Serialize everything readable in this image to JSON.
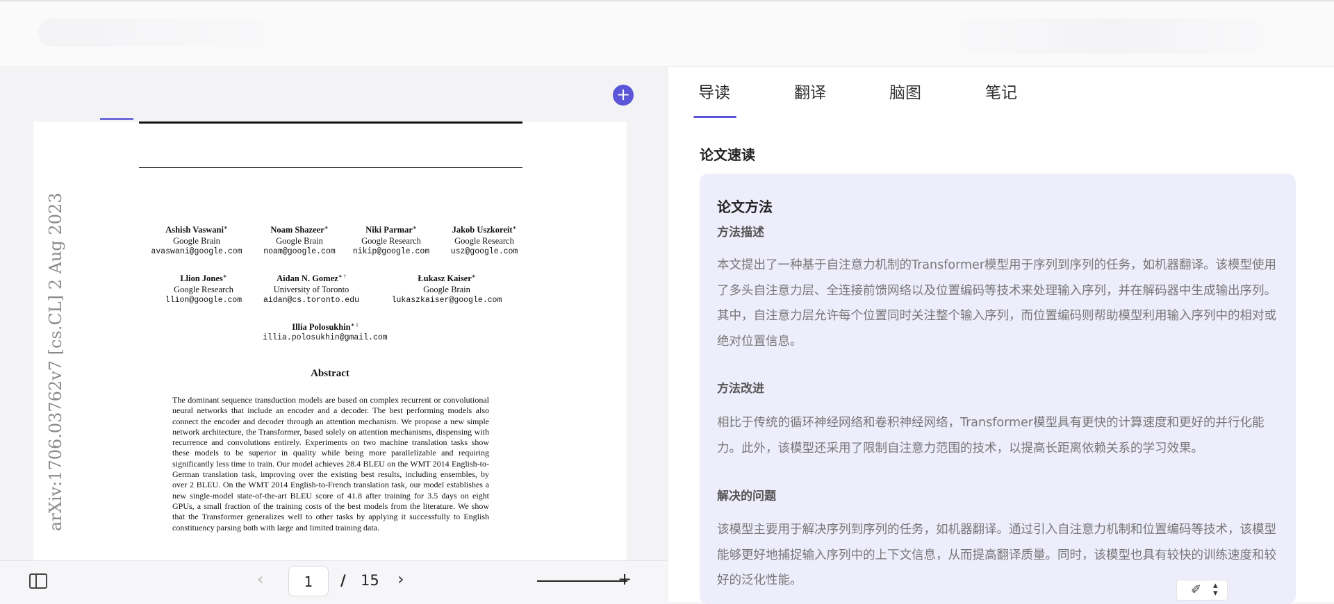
{
  "tabs": [
    {
      "label": "导读"
    },
    {
      "label": "翻译"
    },
    {
      "label": "脑图"
    },
    {
      "label": "笔记"
    }
  ],
  "section_title": "论文速读",
  "card": {
    "title": "论文方法",
    "method_desc_title": "方法描述",
    "method_desc": "本文提出了一种基于自注意力机制的Transformer模型用于序列到序列的任务，如机器翻译。该模型使用了多头自注意力层、全连接前馈网络以及位置编码等技术来处理输入序列，并在解码器中生成输出序列。其中，自注意力层允许每个位置同时关注整个输入序列，而位置编码则帮助模型利用输入序列中的相对或绝对位置信息。",
    "method_improve_title": "方法改进",
    "method_improve": "相比于传统的循环神经网络和卷积神经网络，Transformer模型具有更快的计算速度和更好的并行化能力。此外，该模型还采用了限制自注意力范围的技术，以提高长距离依赖关系的学习效果。",
    "problem_title": "解决的问题",
    "problem": "该模型主要用于解决序列到序列的任务，如机器翻译。通过引入自注意力机制和位置编码等技术，该模型能够更好地捕捉输入序列中的上下文信息，从而提高翻译质量。同时，该模型也具有较快的训练速度和较好的泛化性能。"
  },
  "pdf": {
    "arxiv_stamp": "arXiv:1706.03762v7  [cs.CL]  2 Aug 2023",
    "authors": [
      {
        "name": "Ashish Vaswani",
        "mark": "∗",
        "affil": "Google Brain",
        "email": "avaswani@google.com"
      },
      {
        "name": "Noam Shazeer",
        "mark": "∗",
        "affil": "Google Brain",
        "email": "noam@google.com"
      },
      {
        "name": "Niki Parmar",
        "mark": "∗",
        "affil": "Google Research",
        "email": "nikip@google.com"
      },
      {
        "name": "Jakob Uszkoreit",
        "mark": "∗",
        "affil": "Google Research",
        "email": "usz@google.com"
      },
      {
        "name": "Llion Jones",
        "mark": "∗",
        "affil": "Google Research",
        "email": "llion@google.com"
      },
      {
        "name": "Aidan N. Gomez",
        "mark": "∗ †",
        "affil": "University of Toronto",
        "email": "aidan@cs.toronto.edu"
      },
      {
        "name": "Łukasz Kaiser",
        "mark": "∗",
        "affil": "Google Brain",
        "email": "lukaszkaiser@google.com"
      },
      {
        "name": "Illia Polosukhin",
        "mark": "∗ ‡",
        "affil": "",
        "email": "illia.polosukhin@gmail.com"
      }
    ],
    "abstract_title": "Abstract",
    "abstract": "The dominant sequence transduction models are based on complex recurrent or convolutional neural networks that include an encoder and a decoder. The best performing models also connect the encoder and decoder through an attention mechanism. We propose a new simple network architecture, the Transformer, based solely on attention mechanisms, dispensing with recurrence and convolutions entirely. Experiments on two machine translation tasks show these models to be superior in quality while being more parallelizable and requiring significantly less time to train. Our model achieves 28.4 BLEU on the WMT 2014 English-to-German translation task, improving over the existing best results, including ensembles, by over 2 BLEU. On the WMT 2014 English-to-French translation task, our model establishes a new single-model state-of-the-art BLEU score of 41.8 after training for 3.5 days on eight GPUs, a small fraction of the training costs of the best models from the literature. We show that the Transformer generalizes well to other tasks by applying it successfully to English constituency parsing both with large and limited training data."
  },
  "pager": {
    "current": "1",
    "separator": "/",
    "total": "15",
    "prev_icon": "chevron-left-icon",
    "next_icon": "chevron-right-icon"
  },
  "colors": {
    "accent": "#5b55d8",
    "card_bg": "#eeedfc"
  }
}
